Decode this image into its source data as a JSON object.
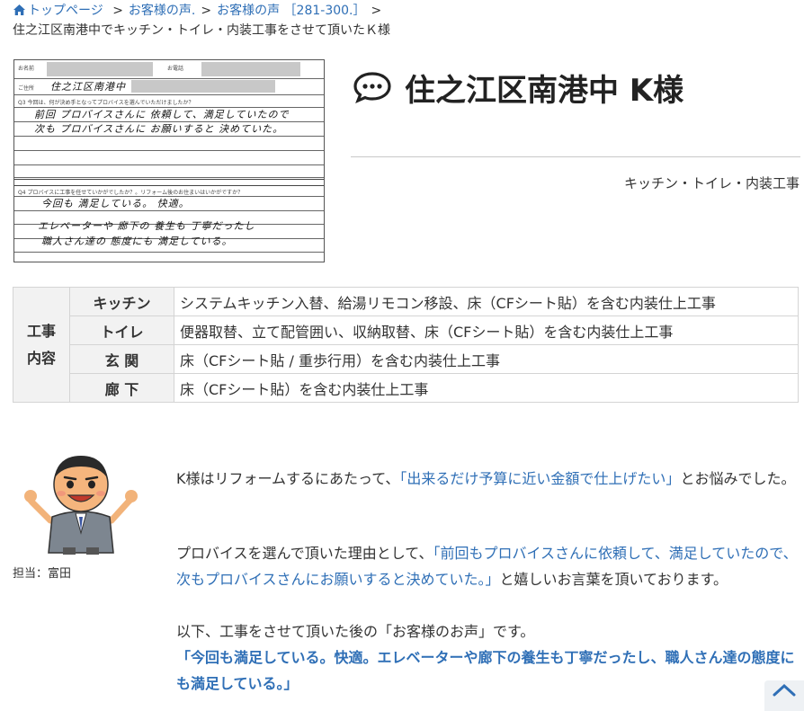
{
  "breadcrumb": {
    "home": "トップページ",
    "voices": "お客様の声.",
    "voices_range": "お客様の声 ［281-300.］",
    "separator": ">",
    "current": "住之江区南港中でキッチン・トイレ・内装工事をさせて頂いたＫ様"
  },
  "survey": {
    "name_label": "お名前",
    "phone_label": "お電話",
    "address_label": "ご住所",
    "address_value": "住之江区南港中",
    "q3": "Q3 今回は、何が決め手となってプロバイスを選んでいただけましたか？",
    "q3_line1": "前回 プロバイスさんに 依頼して、満足していたので",
    "q3_line2": "次も プロバイスさんに お願いすると 決めていた。",
    "q4": "Q4 プロバイスに工事を任せていかがでしたか？。リフォーム後のお住まいはいかがですか？",
    "q4_line1": "今回も 満足している。 快適。",
    "q4_line2": "エレベーターや 廊下の 養生も 丁寧だったし",
    "q4_line3": "職人さん達の 態度にも 満足している。"
  },
  "title": {
    "icon": "chat-bubble-icon",
    "text": "住之江区南港中 K様",
    "work_type": "キッチン・トイレ・内装工事"
  },
  "work_table": {
    "category": "工事内容",
    "rows": [
      {
        "area": "キッチン",
        "desc": "システムキッチン入替、給湯リモコン移設、床（CFシート貼）を含む内装仕上工事"
      },
      {
        "area": "トイレ",
        "desc": "便器取替、立て配管囲い、収納取替、床（CFシート貼）を含む内装仕上工事"
      },
      {
        "area": "玄 関",
        "desc": "床（CFシート貼 / 重歩行用）を含む内装仕上工事"
      },
      {
        "area": "廊 下",
        "desc": "床（CFシート貼）を含む内装仕上工事"
      }
    ]
  },
  "staff": {
    "label": "担当：富田"
  },
  "body": {
    "p1_a": "K様はリフォームするにあたって、",
    "p1_hl": "「出来るだけ予算に近い金額で仕上げたい」",
    "p1_b": "とお悩みでした。",
    "p2_a": "プロバイスを選んで頂いた理由として、",
    "p2_hl": "「前回もプロバイスさんに依頼して、満足していたので、次もプロバイスさんにお願いすると決めていた。」",
    "p2_b": "と嬉しいお言葉を頂いております。",
    "p3_a": "以下、工事をさせて頂いた後の「お客様のお声」です。",
    "p3_hl": "「今回も満足している。快適。エレベーターや廊下の養生も丁寧だったし、職人さん達の態度にも満足している。」"
  },
  "scroll_top": {
    "icon": "chevron-up-icon"
  },
  "colors": {
    "link": "#2f6fb6",
    "table_header_bg": "#f2f2f2",
    "border": "#d4d4d4"
  }
}
